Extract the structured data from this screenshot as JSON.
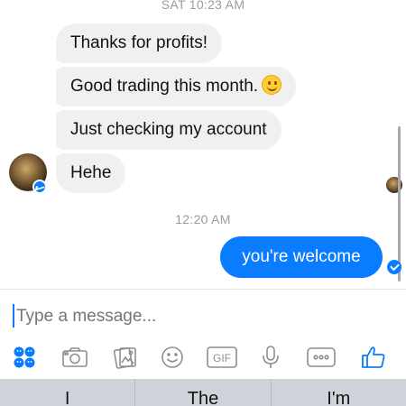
{
  "conversation": {
    "timestamp_top": "SAT 10:23 AM",
    "incoming_messages": [
      "Thanks for profits!",
      "Good trading this month.",
      "Just checking my account",
      "Hehe"
    ],
    "timestamp_mid": "12:20 AM",
    "outgoing_message": "you're welcome"
  },
  "composer": {
    "placeholder": "Type a message..."
  },
  "toolbar": {
    "gif_label": "GIF",
    "icons": [
      "emoji-apps-icon",
      "camera-icon",
      "gallery-icon",
      "smiley-icon",
      "gif-icon",
      "microphone-icon",
      "more-icon",
      "like-icon"
    ],
    "accent_color": "#0a7cff"
  },
  "keyboard": {
    "suggestions": [
      "I",
      "The",
      "I'm"
    ]
  }
}
